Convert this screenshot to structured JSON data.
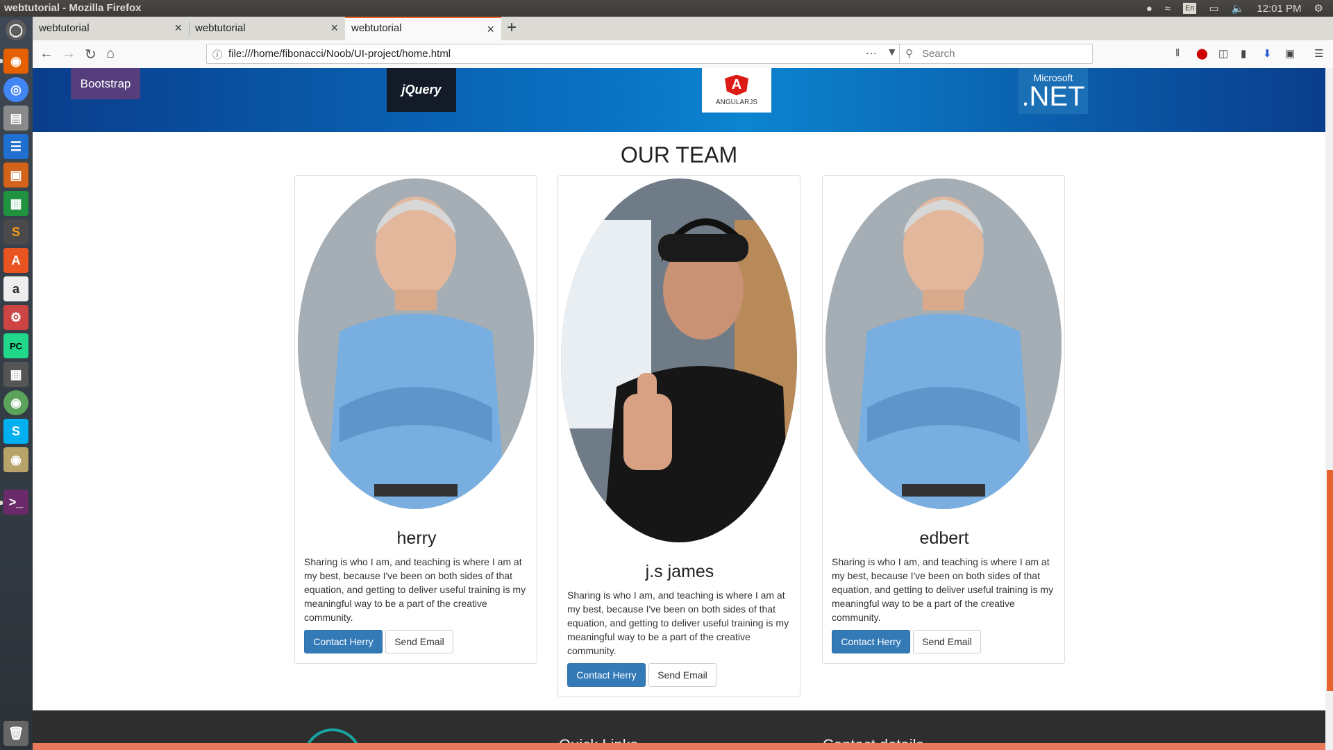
{
  "window": {
    "title": "webtutorial - Mozilla Firefox"
  },
  "tray": {
    "lang": "En",
    "time": "12:01 PM"
  },
  "tabs": [
    {
      "label": "webtutorial"
    },
    {
      "label": "webtutorial"
    },
    {
      "label": "webtutorial"
    }
  ],
  "browser": {
    "url": "file:///home/fibonacci/Noob/UI-project/home.html",
    "search_placeholder": "Search"
  },
  "banner": {
    "logos": [
      "Bootstrap",
      "jQuery",
      "ANGULARJS",
      "Microsoft",
      ".NET"
    ]
  },
  "team": {
    "title": "OUR TEAM",
    "members": [
      {
        "name": "herry",
        "description": "Sharing is who I am, and teaching is where I am at my best, because I've been on both sides of that equation, and getting to deliver useful training is my meaningful way to be a part of the creative community.",
        "contact_label": "Contact Herry",
        "email_label": "Send Email"
      },
      {
        "name": "j.s james",
        "description": "Sharing is who I am, and teaching is where I am at my best, because I've been on both sides of that equation, and getting to deliver useful training is my meaningful way to be a part of the creative community.",
        "contact_label": "Contact Herry",
        "email_label": "Send Email"
      },
      {
        "name": "edbert",
        "description": "Sharing is who I am, and teaching is where I am at my best, because I've been on both sides of that equation, and getting to deliver useful training is my meaningful way to be a part of the creative community.",
        "contact_label": "Contact Herry",
        "email_label": "Send Email"
      }
    ]
  },
  "footer": {
    "col1": "Quick Links",
    "col2": "Contact details"
  },
  "colors": {
    "accent": "#e8642e",
    "primary_button": "#337ab7",
    "footer": "#2e2e2e"
  }
}
